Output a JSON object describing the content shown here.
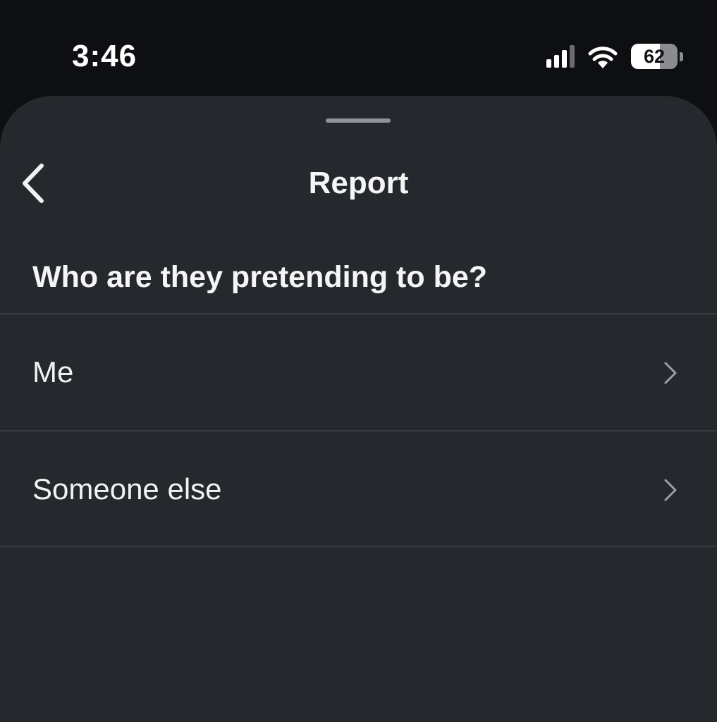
{
  "status_bar": {
    "time": "3:46",
    "battery_level": "62",
    "battery_fraction": 0.62,
    "icons": [
      "signal-icon",
      "wifi-icon",
      "battery-icon"
    ]
  },
  "sheet": {
    "title": "Report",
    "question": "Who are they pretending to be?",
    "options": [
      {
        "label": "Me"
      },
      {
        "label": "Someone else"
      }
    ]
  },
  "colors": {
    "status_background": "#0d0f12",
    "sheet_background": "#25282c",
    "divider": "#383b40",
    "text_primary": "#f5f5f5",
    "chevron": "#9a9ea5"
  }
}
